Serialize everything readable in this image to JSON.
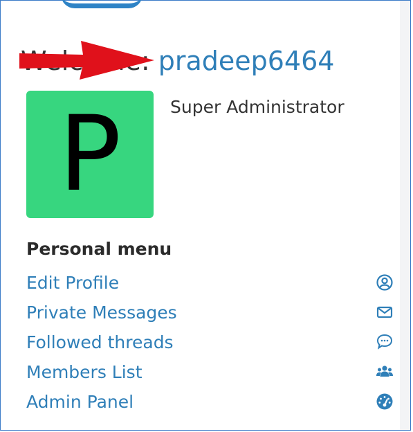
{
  "welcome": {
    "prefix": "Welcome: ",
    "username": "pradeep6464"
  },
  "avatar": {
    "letter": "P",
    "bg_color": "#37d67f"
  },
  "role": "Super Administrator",
  "menu": {
    "heading": "Personal menu",
    "items": [
      {
        "label": "Edit Profile",
        "icon": "user-circle-icon"
      },
      {
        "label": "Private Messages",
        "icon": "envelope-icon"
      },
      {
        "label": "Followed threads",
        "icon": "chat-bubble-icon"
      },
      {
        "label": "Members List",
        "icon": "users-icon"
      },
      {
        "label": "Admin Panel",
        "icon": "dashboard-gauge-icon"
      }
    ]
  },
  "colors": {
    "link": "#2f7fb8",
    "annotation_arrow": "#e0111b",
    "frame_border": "#3b7bc8"
  }
}
